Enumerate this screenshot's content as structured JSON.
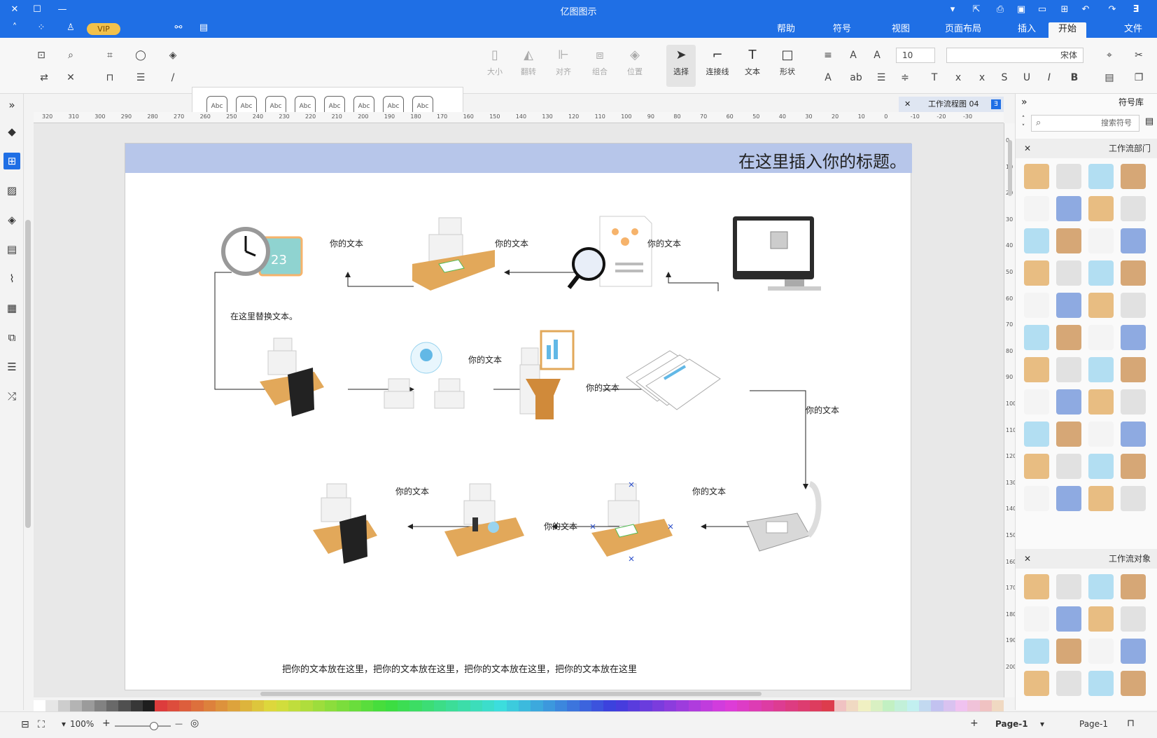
{
  "app": {
    "title": "亿图图示",
    "vip_label": "VIP"
  },
  "menu": {
    "tabs": [
      "文件",
      "开始",
      "插入",
      "页面布局",
      "视图",
      "符号",
      "帮助"
    ],
    "active_tab": "开始"
  },
  "ribbon": {
    "font_name": "宋体",
    "font_size": "10",
    "tools": [
      {
        "label": "形状",
        "icon": "square-icon"
      },
      {
        "label": "文本",
        "icon": "text-icon"
      },
      {
        "label": "连接线",
        "icon": "connector-icon"
      },
      {
        "label": "选择",
        "icon": "select-icon"
      }
    ],
    "arrange": [
      {
        "label": "位置",
        "icon": "layers-icon"
      },
      {
        "label": "组合",
        "icon": "group-icon"
      },
      {
        "label": "对齐",
        "icon": "align-icon"
      },
      {
        "label": "翻转",
        "icon": "flip-icon"
      },
      {
        "label": "大小",
        "icon": "size-icon"
      }
    ],
    "style_swatch_label": "Abc"
  },
  "document": {
    "tab_title": "工作流程图 04"
  },
  "canvas": {
    "page_title": "在这里插入你的标题。",
    "replace_text": "在这里替换文本。",
    "footer_text": "把你的文本放在这里，把你的文本放在这里，把你的文本放在这里，把你的文本放在这里",
    "labels": {
      "l1": "你的文本",
      "l2": "你的文本",
      "l3": "你的文本",
      "l4": "你的文本",
      "l5": "你的文本",
      "l6": "你的文本",
      "l7": "你的文本",
      "l8": "你的文本",
      "l9": "你的文本"
    }
  },
  "ruler": {
    "h_ticks": [
      "320",
      "310",
      "300",
      "290",
      "280",
      "270",
      "260",
      "250",
      "240",
      "230",
      "220",
      "210",
      "200",
      "190",
      "180",
      "170",
      "160",
      "150",
      "140",
      "130",
      "120",
      "110",
      "100",
      "90",
      "80",
      "70",
      "60",
      "50",
      "40",
      "30",
      "20",
      "10",
      "0",
      "-10",
      "-20",
      "-30"
    ],
    "v_ticks": [
      "0",
      "10",
      "20",
      "30",
      "40",
      "50",
      "60",
      "70",
      "80",
      "90",
      "100",
      "110",
      "120",
      "130",
      "140",
      "150",
      "160",
      "170",
      "180",
      "190",
      "200"
    ]
  },
  "right_panel": {
    "title": "符号库",
    "search_placeholder": "搜索符号",
    "section1": "工作流部门",
    "section2": "工作流对象"
  },
  "status": {
    "page_left": "Page-1",
    "page_tab": "Page-1",
    "zoom": "100%"
  },
  "colors": {
    "accent": "#1f6fe5",
    "title_band": "#b7c6ea"
  }
}
